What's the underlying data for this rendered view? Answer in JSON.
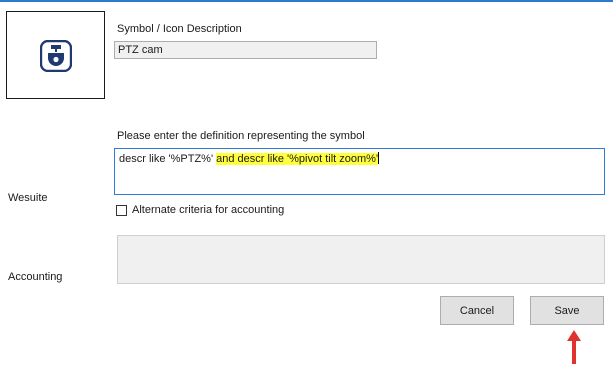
{
  "symbol": {
    "icon": "ptz-camera-icon",
    "icon_color": "#1f3b6d"
  },
  "description": {
    "label": "Symbol / Icon Description",
    "value": "PTZ cam"
  },
  "definition": {
    "label": "Please enter the definition representing the symbol",
    "text_plain": "descr like '%PTZ%' ",
    "text_highlighted": "and descr like '%pivot tilt zoom%'",
    "highlight_color": "#ffff3c"
  },
  "wesuite": {
    "label": "Wesuite"
  },
  "alternate_criteria": {
    "label": "Alternate criteria for accounting",
    "checked": false
  },
  "accounting": {
    "label": "Accounting",
    "value": ""
  },
  "buttons": {
    "cancel_label": "Cancel",
    "save_label": "Save"
  },
  "annotation": {
    "icon": "red-arrow-up-icon",
    "color": "#e0322e"
  }
}
